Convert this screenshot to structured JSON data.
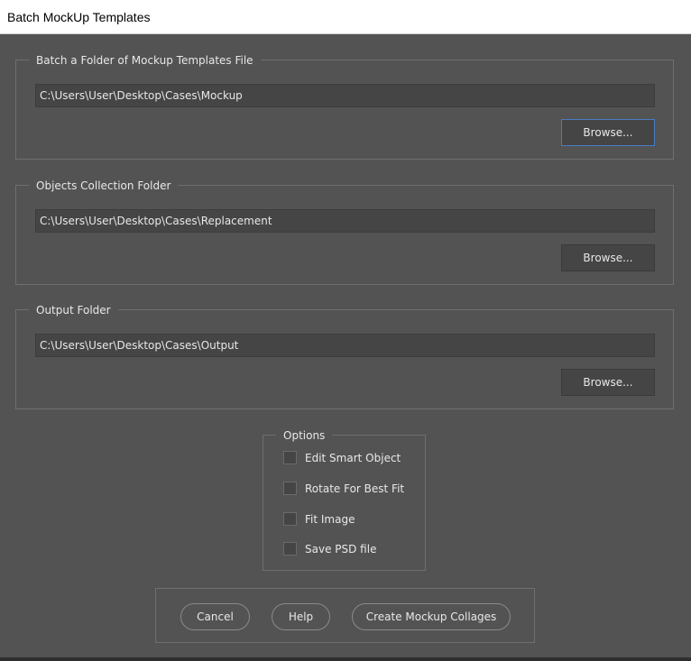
{
  "window": {
    "title": "Batch MockUp Templates"
  },
  "groups": {
    "mockup": {
      "legend": "Batch a Folder of Mockup Templates File",
      "path": "C:\\Users\\User\\Desktop\\Cases\\Mockup",
      "browse_label": "Browse..."
    },
    "objects": {
      "legend": "Objects Collection Folder",
      "path": "C:\\Users\\User\\Desktop\\Cases\\Replacement",
      "browse_label": "Browse..."
    },
    "output": {
      "legend": "Output Folder",
      "path": "C:\\Users\\User\\Desktop\\Cases\\Output",
      "browse_label": "Browse..."
    }
  },
  "options": {
    "legend": "Options",
    "items": [
      {
        "label": "Edit Smart Object",
        "checked": false
      },
      {
        "label": "Rotate For Best Fit",
        "checked": false
      },
      {
        "label": "Fit Image",
        "checked": false
      },
      {
        "label": "Save PSD file",
        "checked": false
      }
    ]
  },
  "actions": {
    "cancel_label": "Cancel",
    "help_label": "Help",
    "create_label": "Create Mockup Collages"
  },
  "colors": {
    "background": "#535353",
    "field": "#454545",
    "focus_accent": "#4a7cc7"
  }
}
